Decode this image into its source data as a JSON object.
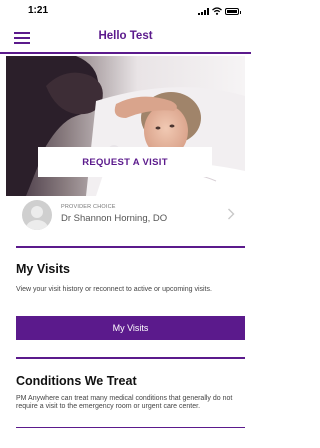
{
  "status_bar": {
    "time": "1:21"
  },
  "nav": {
    "title": "Hello Test"
  },
  "hero": {
    "request_button_label": "REQUEST A VISIT"
  },
  "provider": {
    "label": "PROVIDER CHOICE",
    "name": "Dr Shannon Horning, DO"
  },
  "my_visits": {
    "title": "My Visits",
    "description": "View your visit history or reconnect to active or upcoming visits.",
    "button_label": "My Visits"
  },
  "conditions": {
    "title": "Conditions We Treat",
    "description": "PM Anywhere can treat many medical conditions that generally do not require a visit to the emergency room or urgent care center."
  },
  "colors": {
    "brand_purple": "#5b1a8c"
  }
}
